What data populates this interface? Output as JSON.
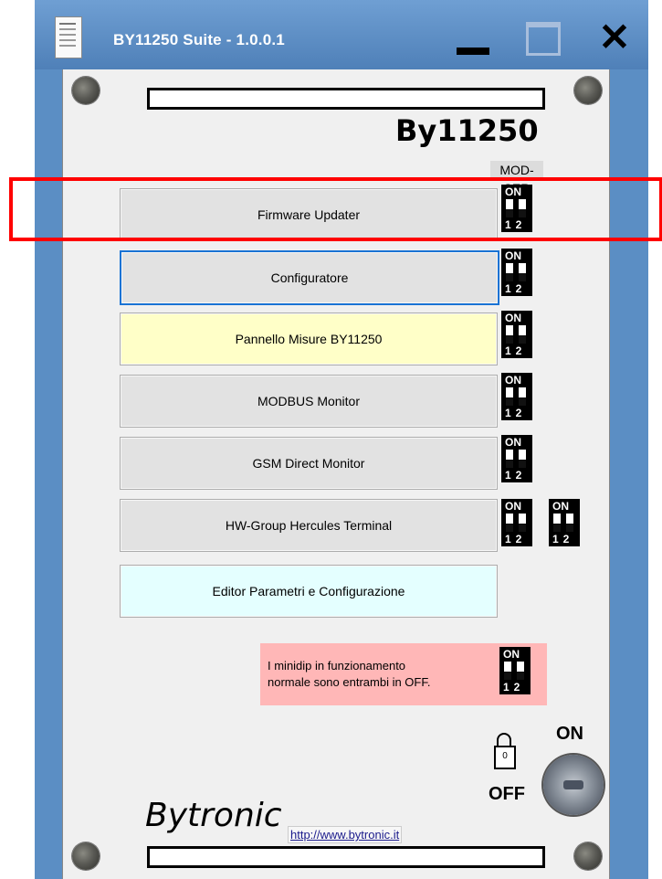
{
  "window": {
    "title": "BY11250 Suite - 1.0.0.1",
    "minimize_icon": "minimize-icon",
    "maximize_icon": "maximize-icon",
    "close_icon": "close-icon"
  },
  "header": {
    "model": "By11250",
    "modser_label": "MOD-SER"
  },
  "buttons": [
    {
      "label": "Firmware Updater"
    },
    {
      "label": "Configuratore"
    },
    {
      "label": "Pannello Misure BY11250"
    },
    {
      "label": "MODBUS Monitor"
    },
    {
      "label": "GSM Direct Monitor"
    },
    {
      "label": "HW-Group Hercules Terminal"
    },
    {
      "label": "Editor Parametri e Configurazione"
    }
  ],
  "dip": {
    "on_label": "ON",
    "numbers": "12"
  },
  "note": {
    "text": "I minidip in funzionamento\nnormale sono entrambi in OFF."
  },
  "lock": {
    "on_label": "ON",
    "off_label": "OFF",
    "lock_glyph": "0"
  },
  "footer": {
    "brand": "Bytronic",
    "link": "http://www.bytronic.it"
  },
  "colors": {
    "titlebar": "#5b8ec4",
    "highlight": "#ff0000",
    "note_bg": "#ffb7b7",
    "yellow_button": "#ffffc8",
    "cyan_button": "#e4ffff"
  }
}
